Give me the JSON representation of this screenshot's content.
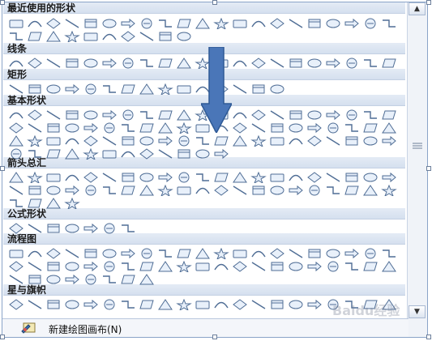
{
  "sections": [
    {
      "label": "最近使用的形状"
    },
    {
      "label": "线条"
    },
    {
      "label": "矩形"
    },
    {
      "label": "基本形状"
    },
    {
      "label": "箭头总汇"
    },
    {
      "label": "公式形状"
    },
    {
      "label": "流程图"
    },
    {
      "label": "星与旗帜"
    }
  ],
  "footer": {
    "new_canvas_label": "新建绘图画布(N)"
  },
  "watermark": "Baidu经验",
  "colors": {
    "shape_outline": "#4f6d95",
    "shape_fill": "#e8f0fa",
    "arrow_fill": "#4a76b8",
    "header_bg": "#dbe4f1"
  },
  "icons": [
    "shape-icon",
    "scroll-up-icon",
    "scroll-down-icon",
    "scroll-grip-icon",
    "canvas-icon",
    "down-arrow-annotation-icon"
  ]
}
